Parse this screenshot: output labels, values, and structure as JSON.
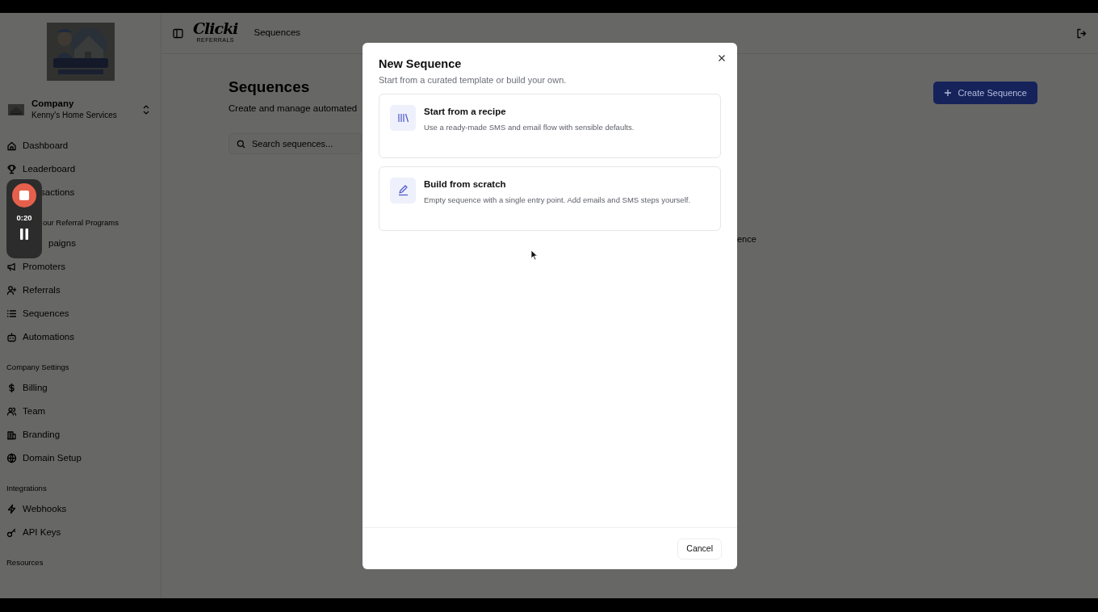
{
  "brand": {
    "name": "Clicki",
    "tagline": "REFERRALS"
  },
  "breadcrumb": "Sequences",
  "company": {
    "label": "Company",
    "name": "Kenny's Home Services"
  },
  "sidebar": {
    "sections": [
      {
        "items": [
          {
            "label": "Dashboard",
            "covered": false
          },
          {
            "label": "Leaderboard",
            "covered": false
          },
          {
            "label": "sactions",
            "covered": true
          }
        ]
      },
      {
        "title": "our Referral Programs",
        "title_covered": true,
        "items": [
          {
            "label": "paigns",
            "covered": true
          },
          {
            "label": "Promoters",
            "covered": false
          },
          {
            "label": "Referrals",
            "covered": false
          },
          {
            "label": "Sequences",
            "covered": false
          },
          {
            "label": "Automations",
            "covered": false
          }
        ]
      },
      {
        "title": "Company Settings",
        "title_covered": false,
        "items": [
          {
            "label": "Billing",
            "covered": false
          },
          {
            "label": "Team",
            "covered": false
          },
          {
            "label": "Branding",
            "covered": false
          },
          {
            "label": "Domain Setup",
            "covered": false
          }
        ]
      },
      {
        "title": "Integrations",
        "title_covered": false,
        "items": [
          {
            "label": "Webhooks",
            "covered": false
          },
          {
            "label": "API Keys",
            "covered": false
          }
        ]
      },
      {
        "title": "Resources",
        "title_covered": false
      }
    ]
  },
  "page": {
    "title": "Sequences",
    "subtitle": "Create and manage automated",
    "search": {
      "placeholder": "Search sequences..."
    },
    "create_button": "Create Sequence",
    "empty_state_fragment": "ence"
  },
  "modal": {
    "title": "New Sequence",
    "subtitle": "Start from a curated template or build your own.",
    "options": [
      {
        "title": "Start from a recipe",
        "description": "Use a ready-made SMS and email flow with sensible defaults."
      },
      {
        "title": "Build from scratch",
        "description": "Empty sequence with a single entry point. Add emails and SMS steps yourself."
      }
    ],
    "cancel": "Cancel"
  },
  "recorder": {
    "time": "0:20"
  }
}
